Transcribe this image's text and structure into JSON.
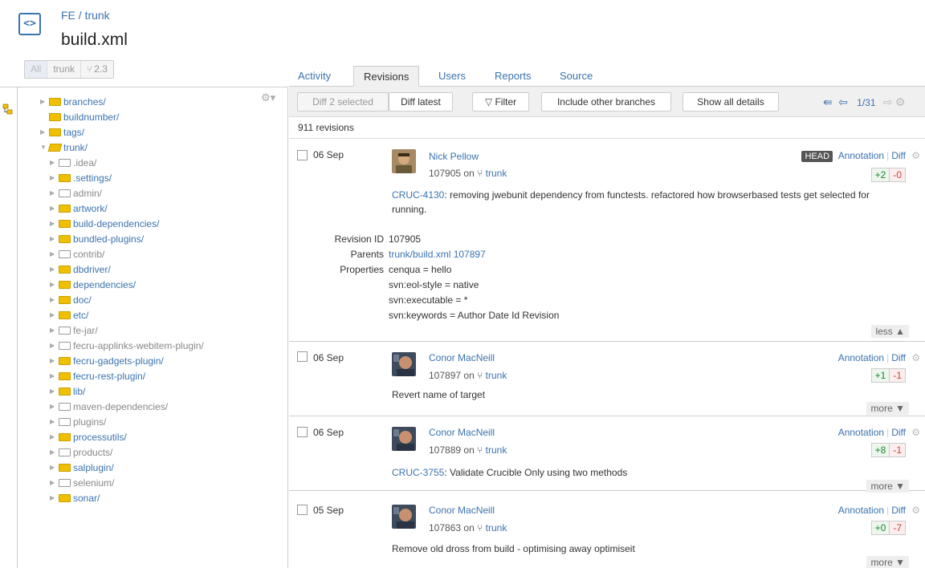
{
  "header": {
    "project": "FE",
    "separator": "/",
    "branch": "trunk",
    "file_title": "build.xml",
    "filter": {
      "all": "All",
      "trunk": "trunk",
      "tag": "2.3"
    }
  },
  "tree": {
    "rows": [
      {
        "label": "branches/",
        "style": "y",
        "arrow": "▶",
        "indent": 0,
        "kind": "link"
      },
      {
        "label": "buildnumber/",
        "style": "y",
        "arrow": "",
        "indent": 0,
        "kind": "link"
      },
      {
        "label": "tags/",
        "style": "y",
        "arrow": "▶",
        "indent": 0,
        "kind": "link"
      },
      {
        "label": "trunk/",
        "style": "o",
        "arrow": "▼",
        "indent": 0,
        "kind": "link"
      },
      {
        "label": ".idea/",
        "style": "g",
        "arrow": "▶",
        "indent": 1,
        "kind": "gray"
      },
      {
        "label": ".settings/",
        "style": "y",
        "arrow": "▶",
        "indent": 1,
        "kind": "link"
      },
      {
        "label": "admin/",
        "style": "g",
        "arrow": "▶",
        "indent": 1,
        "kind": "gray"
      },
      {
        "label": "artwork/",
        "style": "y",
        "arrow": "▶",
        "indent": 1,
        "kind": "link"
      },
      {
        "label": "build-dependencies/",
        "style": "y",
        "arrow": "▶",
        "indent": 1,
        "kind": "link"
      },
      {
        "label": "bundled-plugins/",
        "style": "y",
        "arrow": "▶",
        "indent": 1,
        "kind": "link"
      },
      {
        "label": "contrib/",
        "style": "g",
        "arrow": "▶",
        "indent": 1,
        "kind": "gray"
      },
      {
        "label": "dbdriver/",
        "style": "y",
        "arrow": "▶",
        "indent": 1,
        "kind": "link"
      },
      {
        "label": "dependencies/",
        "style": "y",
        "arrow": "▶",
        "indent": 1,
        "kind": "link"
      },
      {
        "label": "doc/",
        "style": "y",
        "arrow": "▶",
        "indent": 1,
        "kind": "link"
      },
      {
        "label": "etc/",
        "style": "y",
        "arrow": "▶",
        "indent": 1,
        "kind": "link"
      },
      {
        "label": "fe-jar/",
        "style": "g",
        "arrow": "▶",
        "indent": 1,
        "kind": "gray"
      },
      {
        "label": "fecru-applinks-webitem-plugin/",
        "style": "g",
        "arrow": "▶",
        "indent": 1,
        "kind": "gray"
      },
      {
        "label": "fecru-gadgets-plugin/",
        "style": "y",
        "arrow": "▶",
        "indent": 1,
        "kind": "link"
      },
      {
        "label": "fecru-rest-plugin/",
        "style": "y",
        "arrow": "▶",
        "indent": 1,
        "kind": "link"
      },
      {
        "label": "lib/",
        "style": "y",
        "arrow": "▶",
        "indent": 1,
        "kind": "link"
      },
      {
        "label": "maven-dependencies/",
        "style": "g",
        "arrow": "▶",
        "indent": 1,
        "kind": "gray"
      },
      {
        "label": "plugins/",
        "style": "g",
        "arrow": "▶",
        "indent": 1,
        "kind": "gray"
      },
      {
        "label": "processutils/",
        "style": "y",
        "arrow": "▶",
        "indent": 1,
        "kind": "link"
      },
      {
        "label": "products/",
        "style": "g",
        "arrow": "▶",
        "indent": 1,
        "kind": "gray"
      },
      {
        "label": "salplugin/",
        "style": "y",
        "arrow": "▶",
        "indent": 1,
        "kind": "link"
      },
      {
        "label": "selenium/",
        "style": "g",
        "arrow": "▶",
        "indent": 1,
        "kind": "gray"
      },
      {
        "label": "sonar/",
        "style": "y",
        "arrow": "▶",
        "indent": 1,
        "kind": "link"
      }
    ]
  },
  "tabs": [
    {
      "label": "Activity"
    },
    {
      "label": "Revisions"
    },
    {
      "label": "Users"
    },
    {
      "label": "Reports"
    },
    {
      "label": "Source"
    }
  ],
  "toolbar": {
    "diff_selected": "Diff 2 selected",
    "diff_latest": "Diff latest",
    "filter": "Filter",
    "include_branches": "Include other branches",
    "show_details": "Show all details",
    "page": "1/31"
  },
  "count_text": "911 revisions",
  "revisions": [
    {
      "date": "06 Sep",
      "author": "Nick Pellow",
      "rev": "107905",
      "on": "on",
      "branch": "trunk",
      "head": "HEAD",
      "annotation": "Annotation",
      "diff": "Diff",
      "plus": "+2",
      "minus": "-0",
      "msg_key": "CRUC-4130",
      "msg": ": removing jwebunit dependency from functests. refactored how browserbased tests get selected for running.",
      "toggle": "less ▲",
      "details": {
        "revision_id_label": "Revision ID",
        "revision_id": "107905",
        "parents_label": "Parents",
        "parents": "trunk/build.xml 107897",
        "properties_label": "Properties",
        "properties": [
          "cenqua = hello",
          "svn:eol-style = native",
          "svn:executable = *",
          "svn:keywords = Author Date Id Revision"
        ]
      }
    },
    {
      "date": "06 Sep",
      "author": "Conor MacNeill",
      "rev": "107897",
      "on": "on",
      "branch": "trunk",
      "annotation": "Annotation",
      "diff": "Diff",
      "plus": "+1",
      "minus": "-1",
      "msg_key": "",
      "msg": "Revert name of target",
      "toggle": "more ▼"
    },
    {
      "date": "06 Sep",
      "author": "Conor MacNeill",
      "rev": "107889",
      "on": "on",
      "branch": "trunk",
      "annotation": "Annotation",
      "diff": "Diff",
      "plus": "+8",
      "minus": "-1",
      "msg_key": "CRUC-3755",
      "msg": ": Validate Crucible Only using two methods",
      "toggle": "more ▼"
    },
    {
      "date": "05 Sep",
      "author": "Conor MacNeill",
      "rev": "107863",
      "on": "on",
      "branch": "trunk",
      "annotation": "Annotation",
      "diff": "Diff",
      "plus": "+0",
      "minus": "-7",
      "msg_key": "",
      "msg": "Remove old dross from build - optimising away optimiseit",
      "toggle": "more ▼"
    }
  ]
}
